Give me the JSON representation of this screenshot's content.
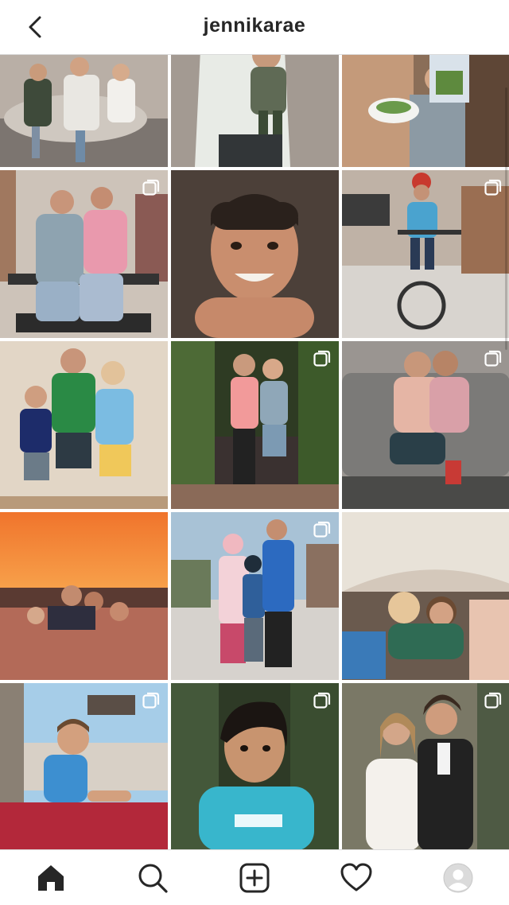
{
  "header": {
    "title": "jennikarae",
    "back_icon": "chevron-left-icon"
  },
  "grid": {
    "posts": [
      {
        "subject": "kids-sitting-on-bench",
        "multi": false,
        "bg": "#b7aba0"
      },
      {
        "subject": "mom-holding-child",
        "multi": false,
        "bg": "#9a8f86"
      },
      {
        "subject": "kids-with-broccoli",
        "multi": false,
        "bg": "#a6836b"
      },
      {
        "subject": "girls-hugging-on-bench",
        "multi": true,
        "bg": "#c9beb4"
      },
      {
        "subject": "smiling-boy-portrait",
        "multi": false,
        "bg": "#5b4a3f"
      },
      {
        "subject": "boy-on-bike",
        "multi": true,
        "bg": "#a49486"
      },
      {
        "subject": "three-kids-at-wall",
        "multi": false,
        "bg": "#d9cbb9"
      },
      {
        "subject": "two-women-by-gate",
        "multi": true,
        "bg": "#3d4a2e"
      },
      {
        "subject": "couple-kissing-on-couch",
        "multi": true,
        "bg": "#8a8480"
      },
      {
        "subject": "sunset-pool",
        "multi": false,
        "bg": "#d97a3a"
      },
      {
        "subject": "three-kids-outdoors",
        "multi": true,
        "bg": "#9fb6c8"
      },
      {
        "subject": "kids-under-blanket-fort",
        "multi": false,
        "bg": "#c9bcae"
      },
      {
        "subject": "toddler-on-playground",
        "multi": true,
        "bg": "#9ec3dc"
      },
      {
        "subject": "boy-in-nike-shirt",
        "multi": true,
        "bg": "#3c4a30"
      },
      {
        "subject": "wedding-couple",
        "multi": true,
        "bg": "#6a6a5a"
      }
    ]
  },
  "nav": {
    "items": [
      {
        "name": "home",
        "icon": "home-icon",
        "active": true
      },
      {
        "name": "search",
        "icon": "search-icon",
        "active": false
      },
      {
        "name": "new-post",
        "icon": "add-post-icon",
        "active": false
      },
      {
        "name": "activity",
        "icon": "heart-icon",
        "active": false
      },
      {
        "name": "profile",
        "icon": "avatar-icon",
        "active": false
      }
    ]
  },
  "colors": {
    "text": "#262626",
    "border": "#dbdbdb",
    "badge": "#ffffff"
  }
}
